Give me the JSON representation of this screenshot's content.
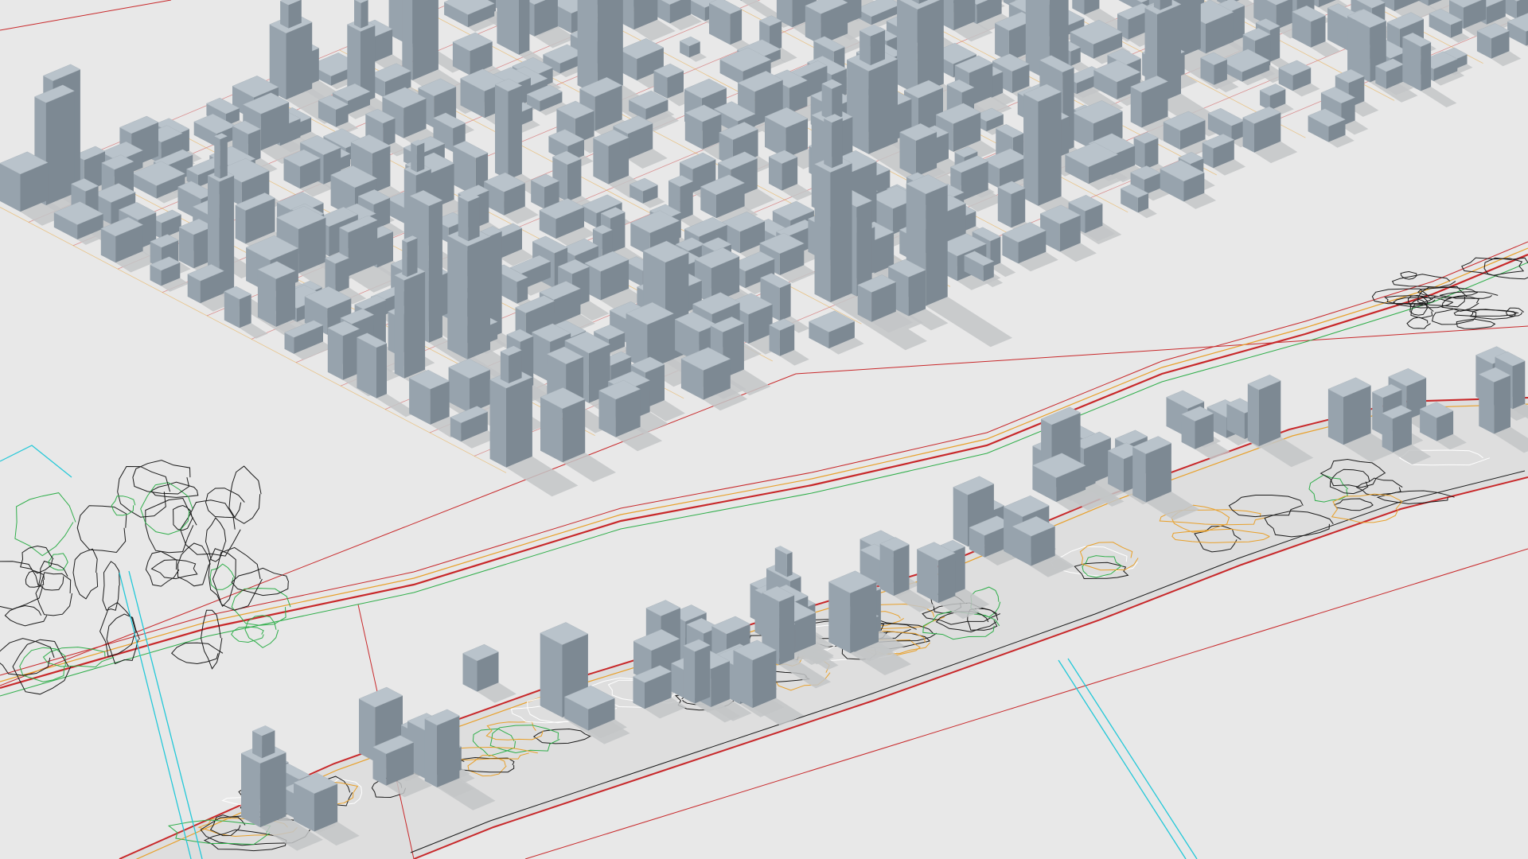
{
  "scene": {
    "kind": "3d-city-model-render",
    "description_tags": [
      "manhattan-grid",
      "river",
      "island",
      "buildings",
      "contour-lines",
      "road-centerlines"
    ],
    "palette": {
      "ground": "#e8e8e8",
      "building_top": "#b9c3cb",
      "building_left": "#97a3ad",
      "building_right": "#7d8993",
      "shadow": "#c3c5c7",
      "road_red": "#c8282a",
      "curb_orange": "#e8a02a",
      "contour_green": "#2fae4a",
      "contour_black": "#1a1a1a",
      "contour_white": "#ffffff",
      "bridge_cyan": "#22c8d8"
    }
  }
}
